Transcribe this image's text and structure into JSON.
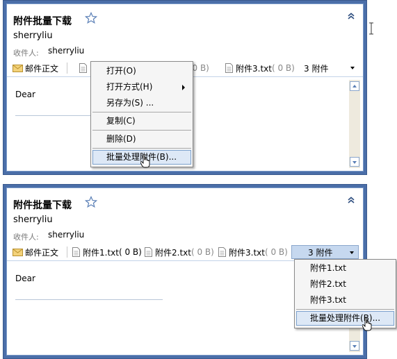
{
  "panel_top": {
    "title": "附件批量下载",
    "sender": "sherryliu",
    "recipient_label": "收件人:",
    "recipient": "sherryliu",
    "mail_body_label": "邮件正文",
    "attachments": [
      {
        "name_visible": "附件",
        "size": ""
      },
      {
        "name_visible": "附件",
        "size": "( 0 B)"
      },
      {
        "name": "附件3.txt",
        "size": "( 0 B)"
      }
    ],
    "attachment_count": "3 附件",
    "body_text": "Dear",
    "context_menu": {
      "open": "打开(O)",
      "open_with": "打开方式(H)",
      "save_as": "另存为(S) ...",
      "copy": "复制(C)",
      "delete": "删除(D)",
      "batch": "批量处理附件(B)..."
    }
  },
  "panel_bottom": {
    "title": "附件批量下载",
    "sender": "sherryliu",
    "recipient_label": "收件人:",
    "recipient": "sherryliu",
    "mail_body_label": "邮件正文",
    "attachments": [
      {
        "name": "附件1.txt",
        "size": "( 0 B)"
      },
      {
        "name": "附件2.txt",
        "size": "( 0 B)"
      },
      {
        "name": "附件3.txt",
        "size": "( 0 B)"
      }
    ],
    "attachment_count": "3 附件",
    "body_text": "Dear",
    "dropdown_menu": {
      "items": [
        "附件1.txt",
        "附件2.txt",
        "附件3.txt"
      ],
      "batch": "批量处理附件(B)..."
    }
  },
  "colors": {
    "frame": "#4a6ea9",
    "menu_highlight": "#dde8f6",
    "pressed_button": "#c6d8ef"
  }
}
